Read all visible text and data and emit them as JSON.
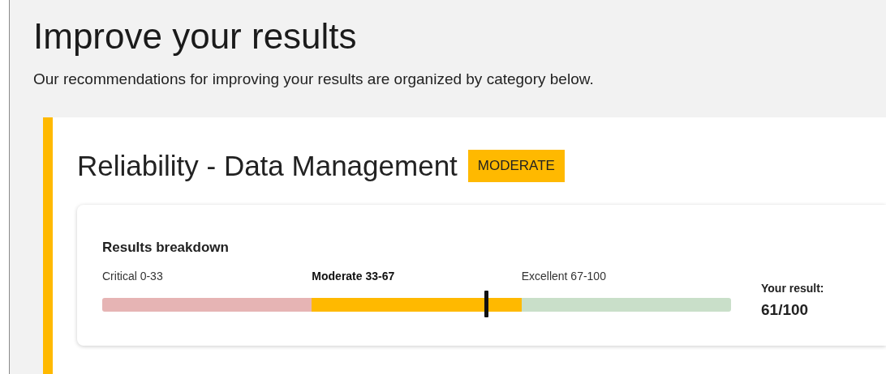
{
  "page": {
    "title": "Improve your results",
    "subtitle": "Our recommendations for improving your results are organized by category below."
  },
  "category": {
    "title": "Reliability - Data Management",
    "badge": "MODERATE",
    "color": "#ffb900",
    "breakdown": {
      "title": "Results breakdown",
      "bands": [
        {
          "label": "Critical 0-33",
          "selected": false,
          "color": "#e6b4b4"
        },
        {
          "label": "Moderate 33-67",
          "selected": true,
          "color": "#ffb900"
        },
        {
          "label": "Excellent 67-100",
          "selected": false,
          "color": "#c9dfc9"
        }
      ],
      "level": 0.61,
      "result_label": "Your result:",
      "result_value": "61/100"
    }
  }
}
